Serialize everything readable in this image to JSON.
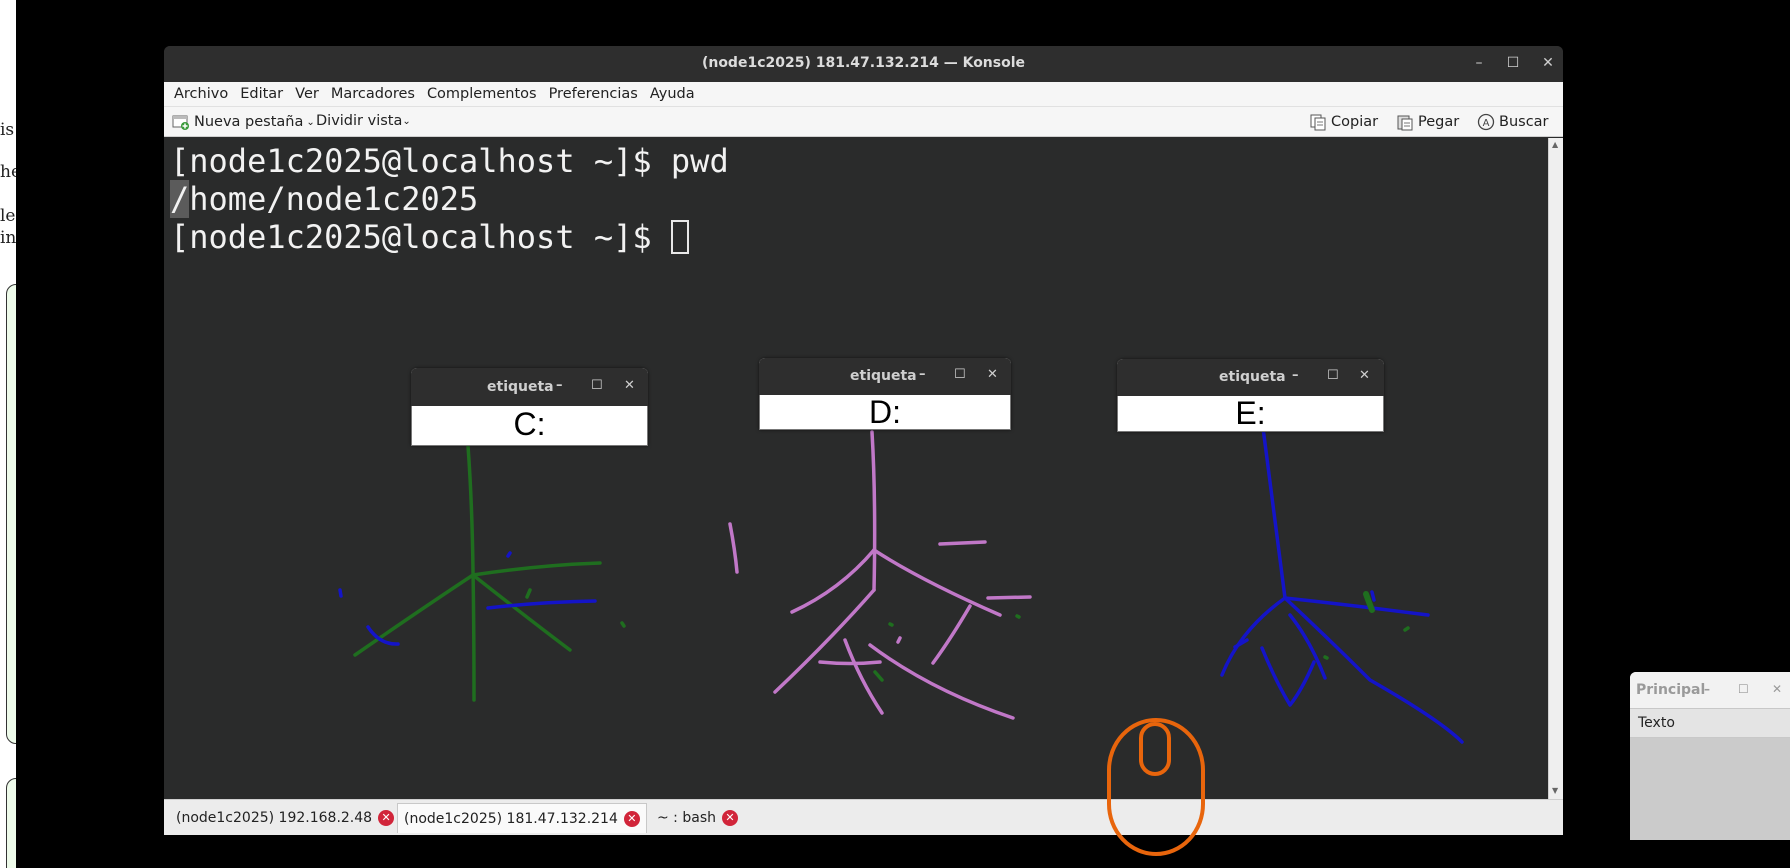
{
  "konsole": {
    "title": "(node1c2025) 181.47.132.214 — Konsole",
    "menu": [
      "Archivo",
      "Editar",
      "Ver",
      "Marcadores",
      "Complementos",
      "Preferencias",
      "Ayuda"
    ],
    "toolbar": {
      "new_tab": "Nueva pestaña",
      "split_view": "Dividir vista",
      "copy": "Copiar",
      "paste": "Pegar",
      "find": "Buscar"
    },
    "terminal": {
      "line1": "[node1c2025@localhost ~]$ pwd",
      "line2_first": "/",
      "line2_rest": "home/node1c2025",
      "line3": "[node1c2025@localhost ~]$ "
    },
    "tabs": [
      "(node1c2025) 192.168.2.48",
      "(node1c2025) 181.47.132.214",
      "~ : bash"
    ]
  },
  "etiquetas": [
    {
      "title": "etiqueta",
      "text": "C:"
    },
    {
      "title": "etiqueta",
      "text": "D:"
    },
    {
      "title": "etiqueta",
      "text": "E:"
    }
  ],
  "principal": {
    "title": "Principal",
    "label": "Texto"
  },
  "background_doc": {
    "fragments": [
      "is",
      "her",
      "lea",
      "ing"
    ]
  },
  "colors": {
    "green": "#1f6e1f",
    "purple": "#c178c8",
    "blue": "#1414c8",
    "mouse": "#e8650c",
    "close_badge": "#d1253a"
  }
}
